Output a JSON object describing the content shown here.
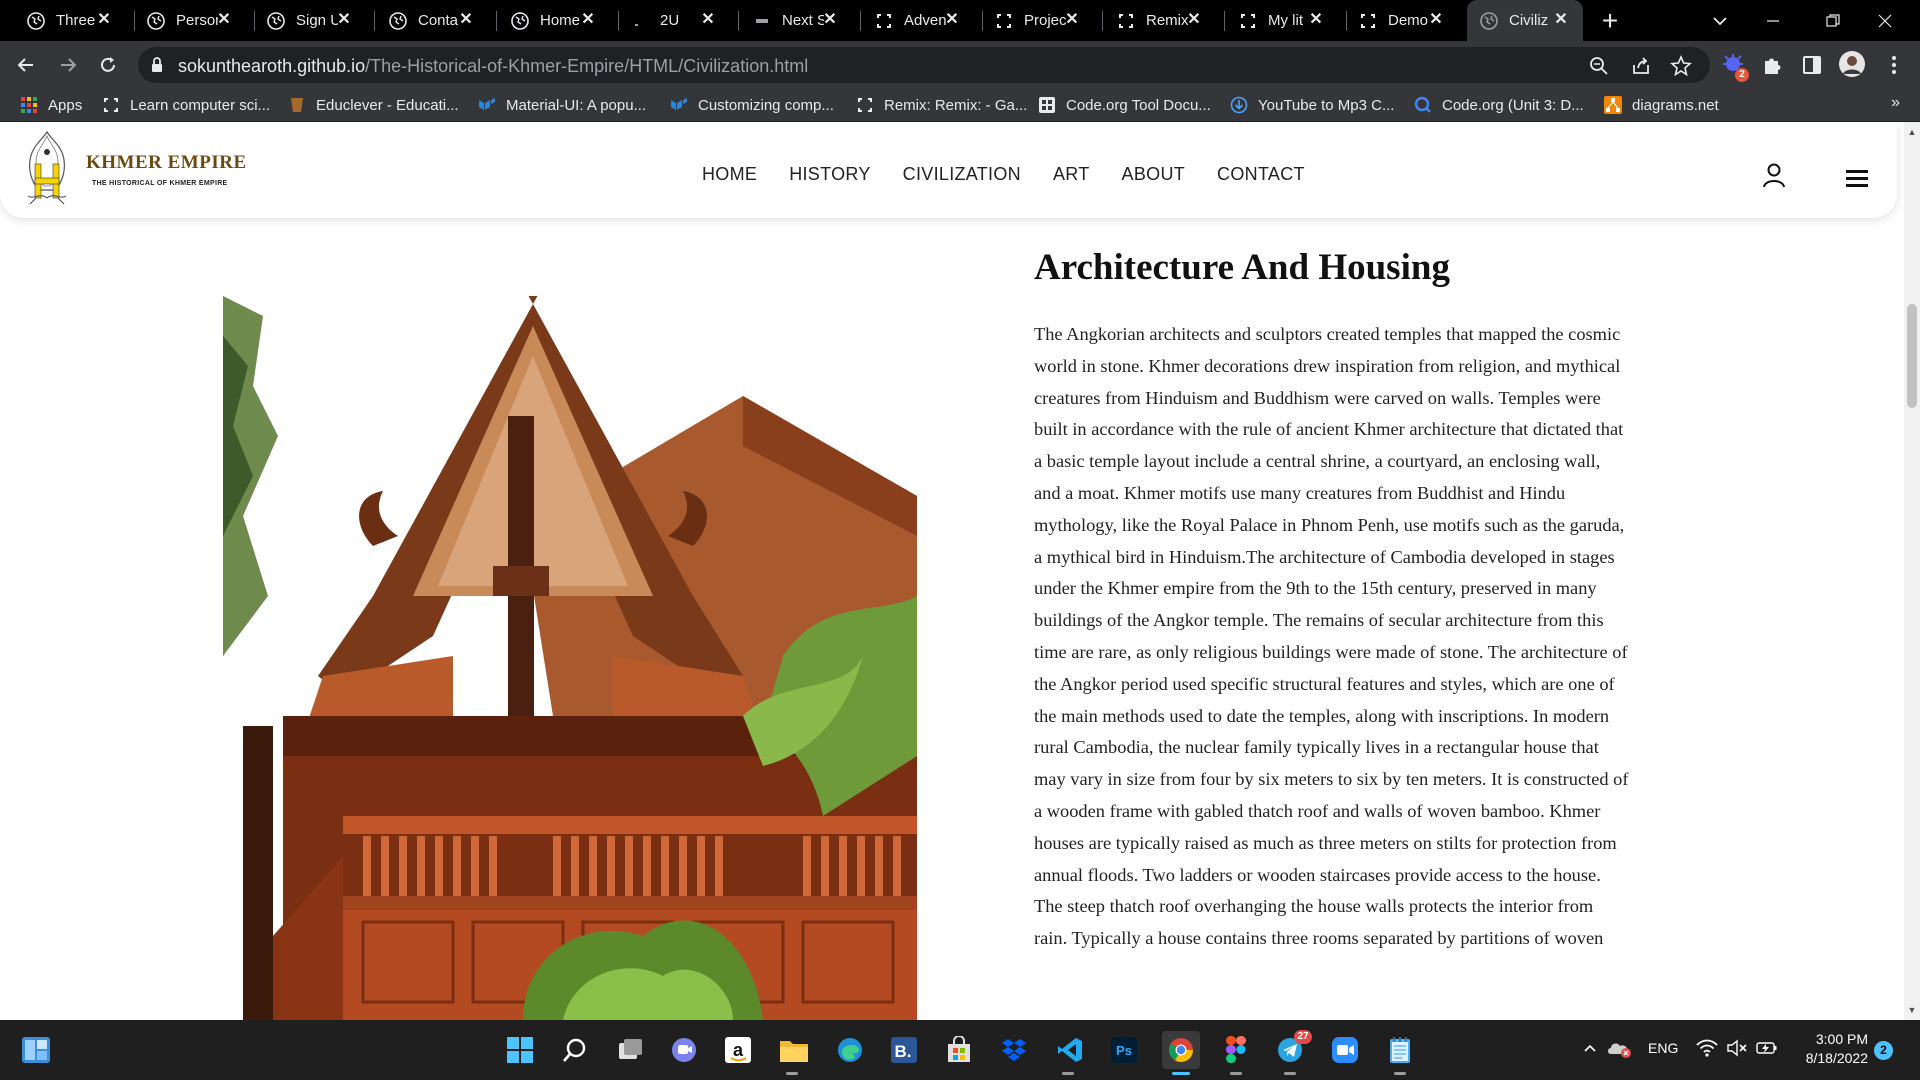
{
  "browser": {
    "tabs": [
      {
        "title": "Three",
        "icon": "globe-icon"
      },
      {
        "title": "Person",
        "icon": "globe-icon"
      },
      {
        "title": "Sign U",
        "icon": "globe-icon"
      },
      {
        "title": "Conta",
        "icon": "globe-icon"
      },
      {
        "title": "Home",
        "icon": "globe-icon"
      },
      {
        "title": "2U",
        "icon": "favicon-2u-icon"
      },
      {
        "title": "Next S",
        "icon": "favicon-next-icon"
      },
      {
        "title": "Adven",
        "icon": "glitch-icon"
      },
      {
        "title": "Projec",
        "icon": "glitch-icon"
      },
      {
        "title": "Remix",
        "icon": "glitch-icon"
      },
      {
        "title": "My lit",
        "icon": "glitch-icon"
      },
      {
        "title": "Demo",
        "icon": "glitch-icon"
      },
      {
        "title": "Civiliz",
        "icon": "globe-icon",
        "active": true
      }
    ],
    "url_host": "sokunthearoth.github.io",
    "url_path": "/The-Historical-of-Khmer-Empire/HTML/Civilization.html",
    "extension_badge": "2",
    "bookmarks": [
      {
        "label": "Apps",
        "icon": "apps-grid-icon"
      },
      {
        "label": "Learn computer sci...",
        "icon": "glitch-icon"
      },
      {
        "label": "Educlever - Educati...",
        "icon": "educlever-icon"
      },
      {
        "label": "Material-UI: A popu...",
        "icon": "mui-icon"
      },
      {
        "label": "Customizing comp...",
        "icon": "mui-icon"
      },
      {
        "label": "Remix: Remix: - Ga...",
        "icon": "glitch-icon"
      },
      {
        "label": "Code.org Tool Docu...",
        "icon": "codeorg-icon"
      },
      {
        "label": "YouTube to Mp3 C...",
        "icon": "download-icon"
      },
      {
        "label": "Code.org (Unit 3: D...",
        "icon": "search-q-icon"
      },
      {
        "label": "diagrams.net",
        "icon": "diagrams-icon"
      }
    ],
    "bookmarks_more": "»"
  },
  "site": {
    "brand": "KHMER EMPIRE",
    "tagline": "THE HISTORICAL OF KHMER EMPIRE",
    "nav": [
      "HOME",
      "HISTORY",
      "CIVILIZATION",
      "ART",
      "ABOUT",
      "CONTACT"
    ],
    "section_title": "Architecture And Housing",
    "section_body": "The Angkorian architects and sculptors created temples that mapped the cosmic world in stone. Khmer decorations drew inspiration from religion, and mythical creatures from Hinduism and Buddhism were carved on walls. Temples were built in accordance with the rule of ancient Khmer architecture that dictated that a basic temple layout include a central shrine, a courtyard, an enclosing wall, and a moat. Khmer motifs use many creatures from Buddhist and Hindu mythology, like the Royal Palace in Phnom Penh, use motifs such as the garuda, a mythical bird in Hinduism.The architecture of Cambodia developed in stages under the Khmer empire from the 9th to the 15th century, preserved in many buildings of the Angkor temple. The remains of secular architecture from this time are rare, as only religious buildings were made of stone. The architecture of the Angkor period used specific structural features and styles, which are one of the main methods used to date the temples, along with inscriptions. In modern rural Cambodia, the nuclear family typically lives in a rectangular house that may vary in size from four by six meters to six by ten meters. It is constructed of a wooden frame with gabled thatch roof and walls of woven bamboo. Khmer houses are typically raised as much as three meters on stilts for protection from annual floods. Two ladders or wooden staircases provide access to the house. The steep thatch roof overhanging the house walls protects the interior from rain. Typically a house contains three rooms separated by partitions of woven"
  },
  "taskbar": {
    "apps": [
      "start-icon",
      "search-icon",
      "task-view-icon",
      "teams-chat-icon",
      "amazon-icon",
      "file-explorer-icon",
      "edge-icon",
      "bold-b-icon",
      "microsoft-store-icon",
      "dropbox-icon",
      "vscode-icon",
      "photoshop-icon",
      "chrome-icon",
      "figma-icon",
      "telegram-icon",
      "zoom-icon",
      "notepad-icon"
    ],
    "telegram_badge": "27",
    "language": "ENG",
    "time": "3:00 PM",
    "date": "8/18/2022",
    "notifications": "2"
  },
  "colors": {
    "tabstrip": "#000000",
    "toolbar": "#35363a",
    "omnibox": "#202124",
    "brand_gold": "#6b4a10",
    "taskbar": "#1f1f1f"
  }
}
